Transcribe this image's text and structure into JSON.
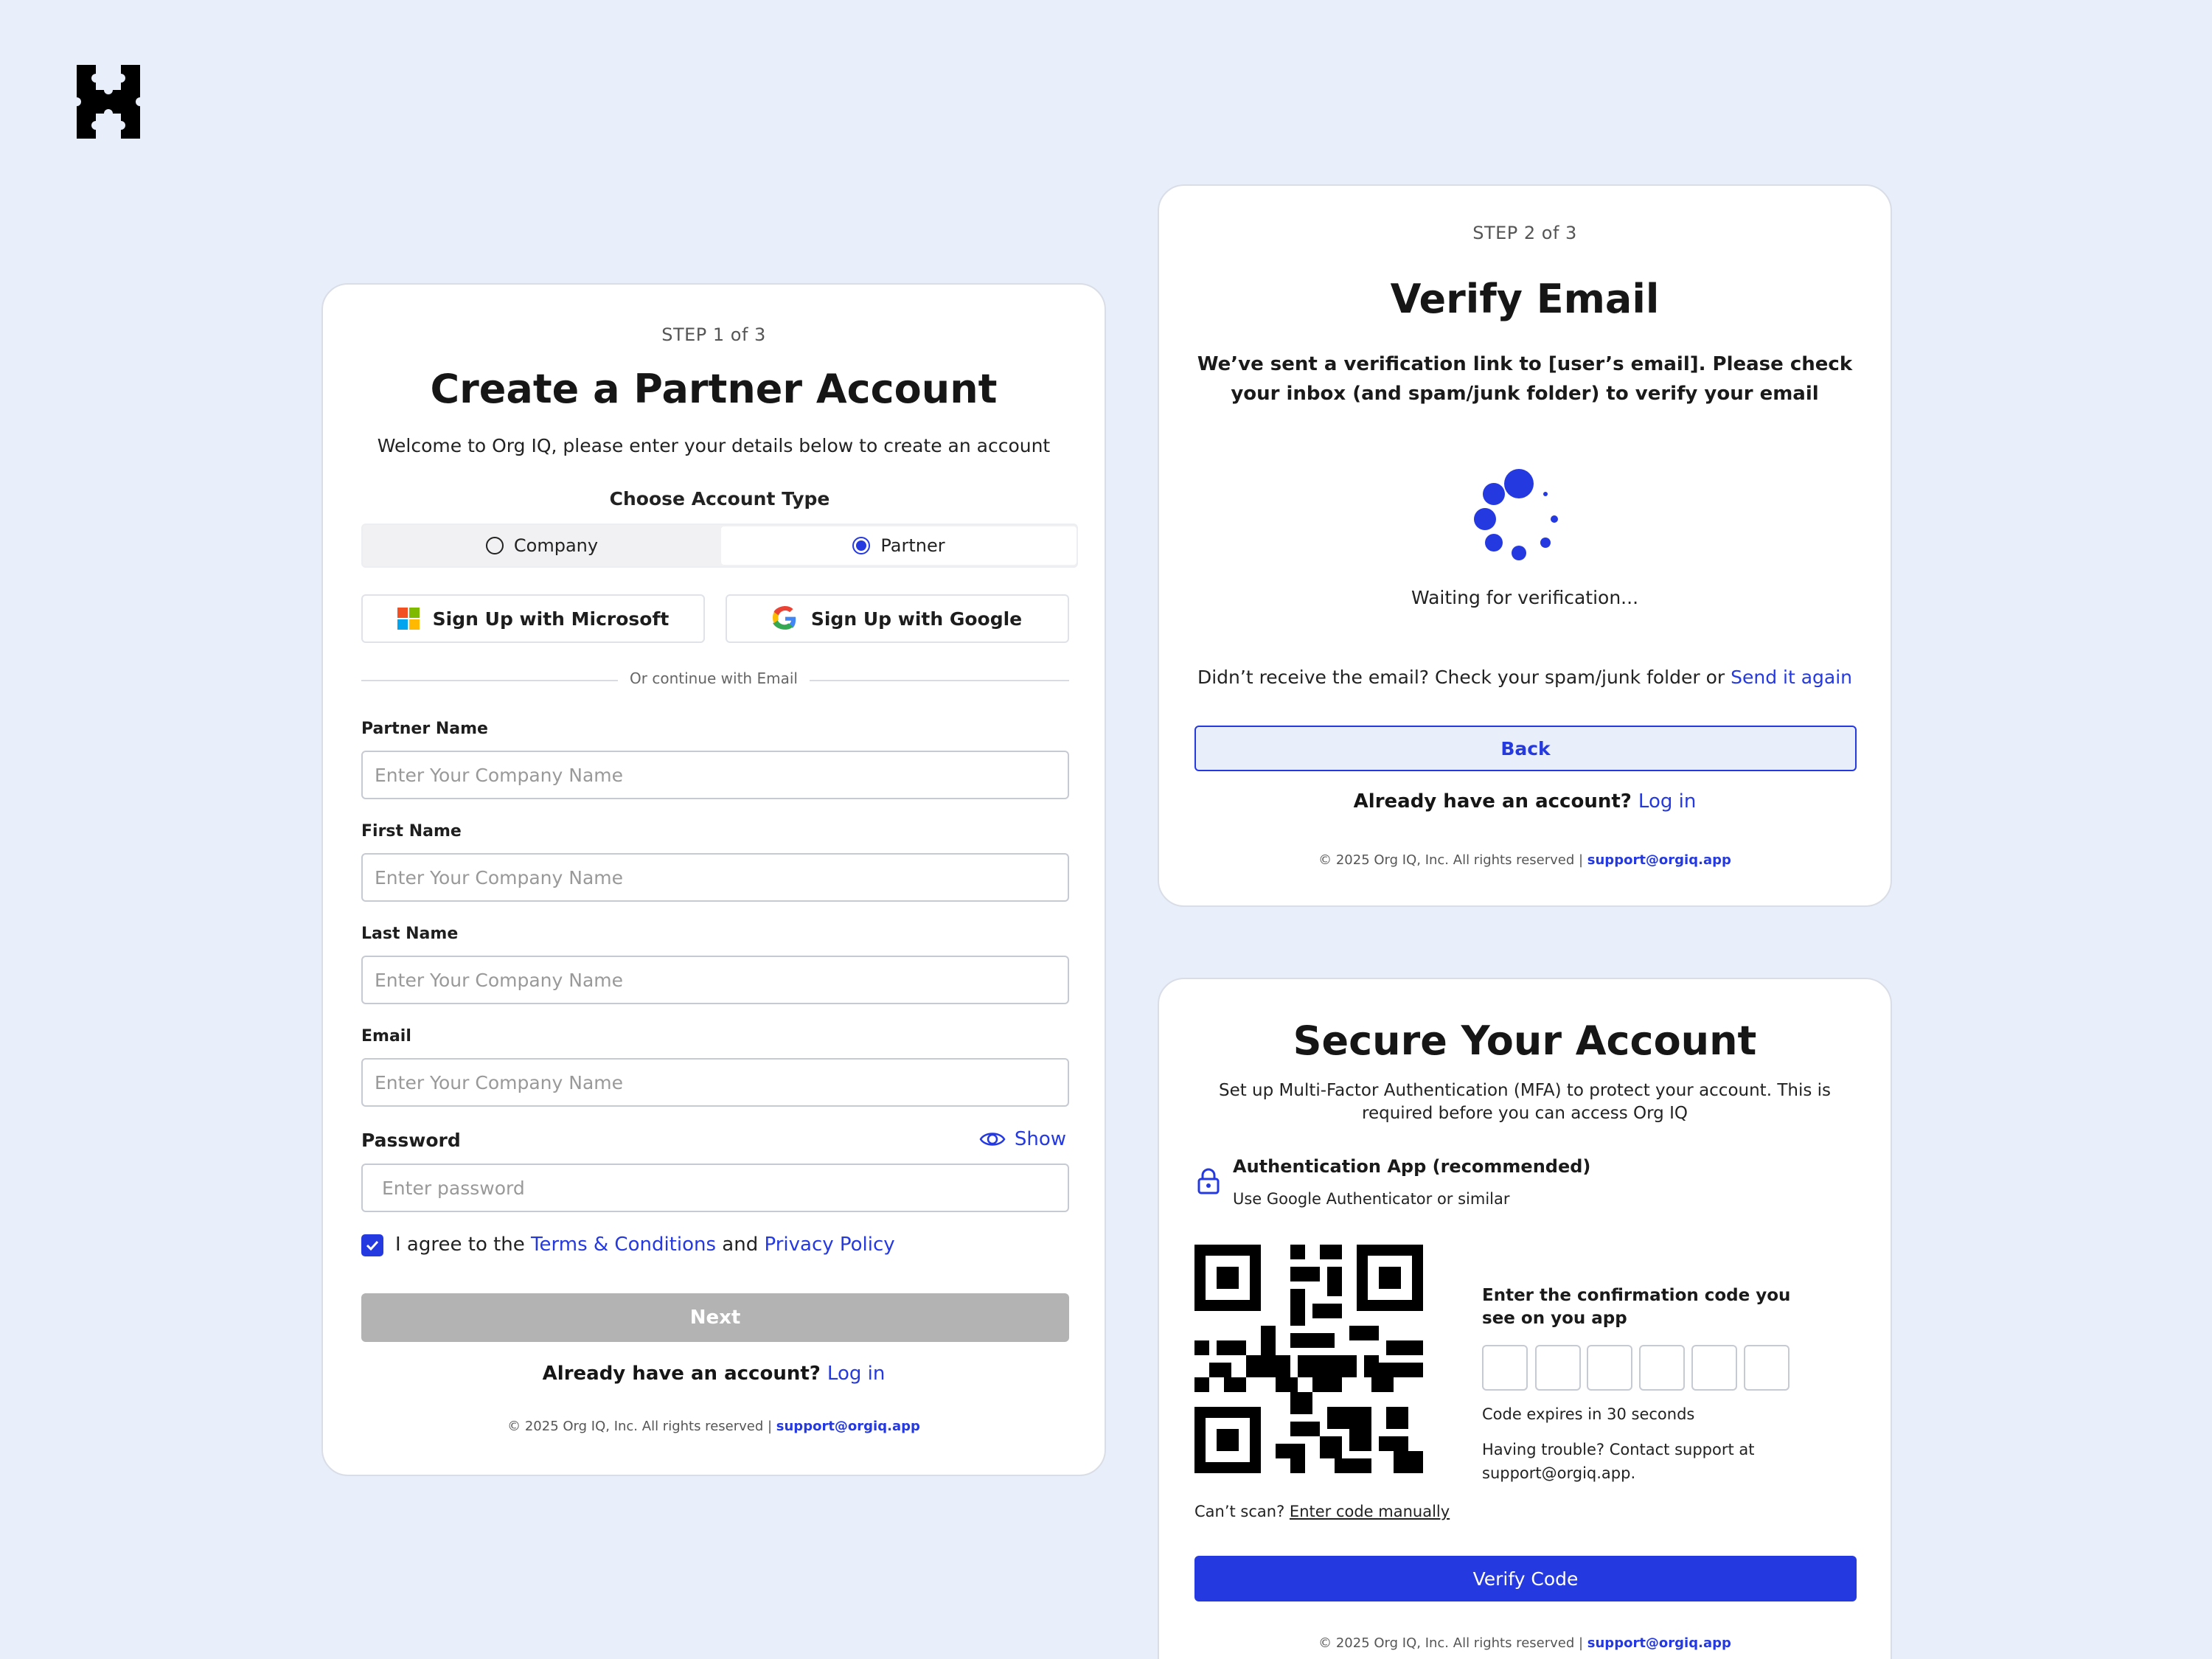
{
  "brand": {
    "logo_icon": "castle-puzzle-logo-icon"
  },
  "colors": {
    "accent": "#2539e1",
    "background": "#e8eefa",
    "disabled": "#b3b3b3"
  },
  "signup": {
    "step": "STEP 1 of 3",
    "title": "Create a Partner Account",
    "subtitle": "Welcome to Org IQ, please enter your details below to create an account",
    "account_type_label": "Choose Account Type",
    "account_types": [
      {
        "label": "Company",
        "selected": false
      },
      {
        "label": "Partner",
        "selected": true
      }
    ],
    "sso_microsoft": "Sign Up with Microsoft",
    "sso_google": "Sign Up with Google",
    "divider": "Or continue with Email",
    "fields": [
      {
        "label": "Partner Name",
        "placeholder": "Enter Your Company Name"
      },
      {
        "label": "First Name",
        "placeholder": "Enter Your Company Name"
      },
      {
        "label": "Last Name",
        "placeholder": "Enter Your Company Name"
      },
      {
        "label": "Email",
        "placeholder": "Enter Your Company Name"
      }
    ],
    "password_label": "Password",
    "password_show": "Show",
    "password_placeholder": "Enter password",
    "agree_prefix": "I agree to the ",
    "terms": "Terms & Conditions",
    "agree_and": " and ",
    "privacy": "Privacy Policy",
    "agree_checked": true,
    "next": "Next",
    "already": "Already have an account?",
    "login": "Log in",
    "footer": "© 2025 Org IQ, Inc. All rights reserved | ",
    "support": "support@orgiq.app"
  },
  "verify": {
    "step": "STEP 2 of 3",
    "title": "Verify Email",
    "message": "We’ve sent a verification link to [user’s email]. Please check your inbox (and spam/junk folder) to verify your email",
    "waiting": "Waiting for verification...",
    "resend_prefix": "Didn’t receive the email? Check your spam/junk folder or ",
    "resend_link": "Send it again",
    "back": "Back",
    "already": "Already have an account?",
    "login": "Log in",
    "footer": "© 2025 Org IQ, Inc. All rights reserved | ",
    "support": "support@orgiq.app"
  },
  "mfa": {
    "title": "Secure Your Account",
    "subtitle": "Set up Multi-Factor Authentication (MFA) to protect your account. This is required before you can access Org IQ",
    "method_title": "Authentication App (recommended)",
    "method_desc": "Use Google Authenticator or similar",
    "code_prompt": "Enter the confirmation code you see on you app",
    "code_expiry": "Code expires in 30 seconds",
    "trouble": "Having trouble? Contact support at support@orgiq.app.",
    "cant_scan": "Can’t scan? ",
    "enter_manual": "Enter code manually",
    "verify": "Verify Code",
    "footer": "© 2025 Org IQ, Inc. All rights reserved | ",
    "support": "support@orgiq.app"
  }
}
